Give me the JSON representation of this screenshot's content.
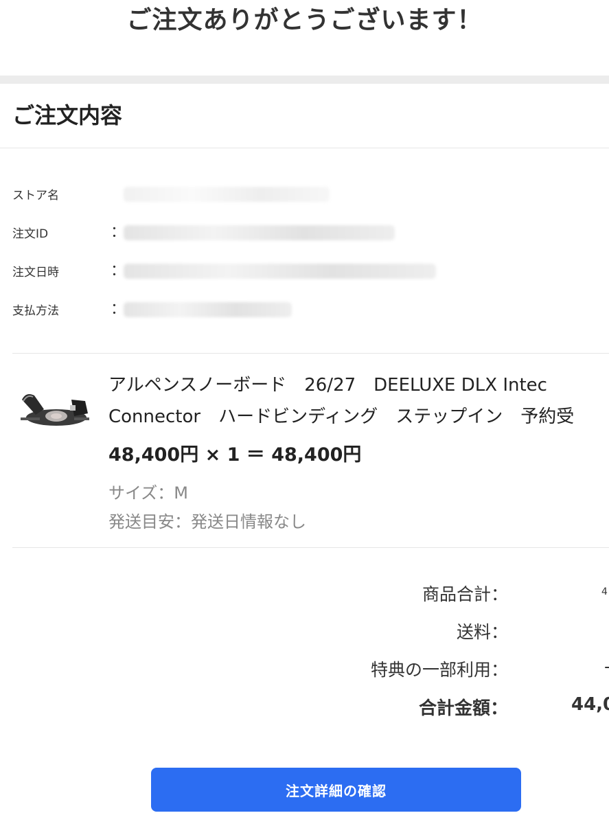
{
  "header": {
    "title": "ご注文ありがとうございます！"
  },
  "order": {
    "section_title": "ご注文内容",
    "info_rows": [
      {
        "label": "ストア名",
        "colon": ":"
      },
      {
        "label": "注文ID",
        "colon": "："
      },
      {
        "label": "注文日時",
        "colon": "："
      },
      {
        "label": "支払方法",
        "colon": "："
      }
    ]
  },
  "item": {
    "title_line1": "アルペンスノーボード　26/27　DEELUXE DLX Intec",
    "title_line2": "Connector　ハードビンディング　ステップイン　予約受",
    "price_line": "48,400円 × 1 ＝ 48,400円",
    "size": "サイズ：M",
    "shipping": "発送目安：発送日情報なし",
    "thumbnail_icon": "binding-product-image"
  },
  "summary": {
    "rows": [
      {
        "label": "商品合計：",
        "value": "4"
      },
      {
        "label": "送料：",
        "value": ""
      },
      {
        "label": "特典の一部利用：",
        "value": "-"
      },
      {
        "label": "合計金額：",
        "value": "44,0"
      }
    ]
  },
  "actions": {
    "detail_button": "注文詳細の確認"
  },
  "colors": {
    "primary_button": "#2c6df2",
    "band": "#ececec",
    "muted_text": "#888888"
  }
}
